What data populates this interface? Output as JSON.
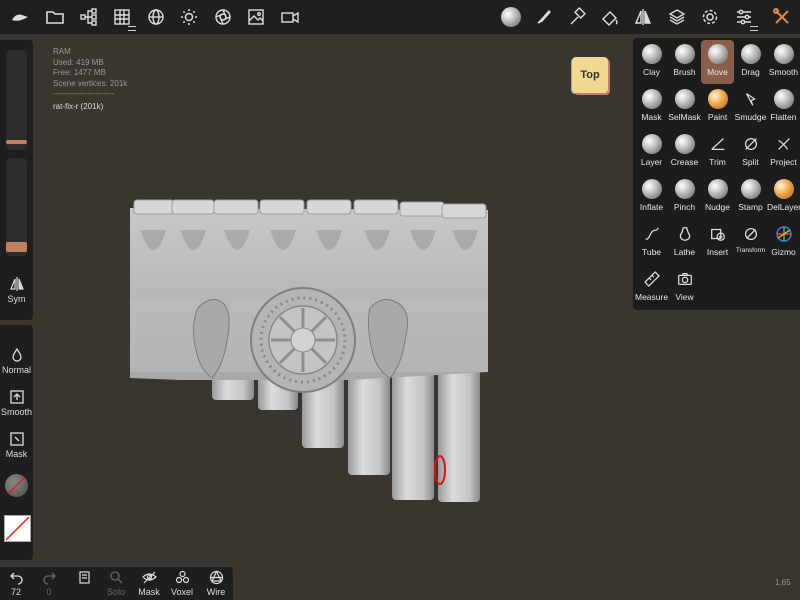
{
  "top_toolbar": {
    "left_icons": [
      "logo-icon",
      "folder-icon",
      "scene-tree-icon",
      "grid-icon",
      "globe-icon",
      "sun-icon",
      "aperture-icon",
      "image-icon",
      "video-icon"
    ],
    "right_icons": [
      "material-sphere-icon",
      "brush-icon",
      "hammer-icon",
      "paint-tool-icon",
      "symmetry-icon",
      "layers-icon",
      "gear-icon",
      "sliders-icon",
      "tools-icon"
    ]
  },
  "info": {
    "ram_label": "RAM",
    "used": "Used: 419 MB",
    "free": "Free: 1477 MB",
    "vertices": "Scene vertices: 201k",
    "separator": "-----------------------",
    "mesh_name": "rat-fix-r (201k)"
  },
  "view_cube": {
    "label": "Top"
  },
  "left_panel": {
    "sym_label": "Sym",
    "normal_label": "Normal",
    "smooth_label": "Smooth",
    "mask_label": "Mask"
  },
  "bottom_bar": {
    "undo_count": "72",
    "redo_count": "0",
    "solo_label": "Solo",
    "mask_label": "Mask",
    "voxel_label": "Voxel",
    "wire_label": "Wire"
  },
  "tools": [
    {
      "label": "Clay",
      "icon": "sphere"
    },
    {
      "label": "Brush",
      "icon": "sphere"
    },
    {
      "label": "Move",
      "icon": "sphere",
      "active": true
    },
    {
      "label": "Drag",
      "icon": "sphere"
    },
    {
      "label": "Smooth",
      "icon": "sphere"
    },
    {
      "label": "Mask",
      "icon": "sphere"
    },
    {
      "label": "SelMask",
      "icon": "sphere"
    },
    {
      "label": "Paint",
      "icon": "sphere-orange"
    },
    {
      "label": "Smudge",
      "icon": "smudge"
    },
    {
      "label": "Flatten",
      "icon": "sphere"
    },
    {
      "label": "Layer",
      "icon": "sphere"
    },
    {
      "label": "Crease",
      "icon": "sphere"
    },
    {
      "label": "Trim",
      "icon": "trim"
    },
    {
      "label": "Split",
      "icon": "split"
    },
    {
      "label": "Project",
      "icon": "project"
    },
    {
      "label": "Inflate",
      "icon": "sphere"
    },
    {
      "label": "Pinch",
      "icon": "sphere"
    },
    {
      "label": "Nudge",
      "icon": "sphere"
    },
    {
      "label": "Stamp",
      "icon": "sphere"
    },
    {
      "label": "DelLayer",
      "icon": "sphere-orange"
    },
    {
      "label": "Tube",
      "icon": "tube"
    },
    {
      "label": "Lathe",
      "icon": "lathe"
    },
    {
      "label": "Insert",
      "icon": "insert"
    },
    {
      "label": "Transform",
      "icon": "transform"
    },
    {
      "label": "Gizmo",
      "icon": "gizmo"
    },
    {
      "label": "Measure",
      "icon": "measure"
    },
    {
      "label": "View",
      "icon": "camera"
    }
  ],
  "version": "1.65"
}
